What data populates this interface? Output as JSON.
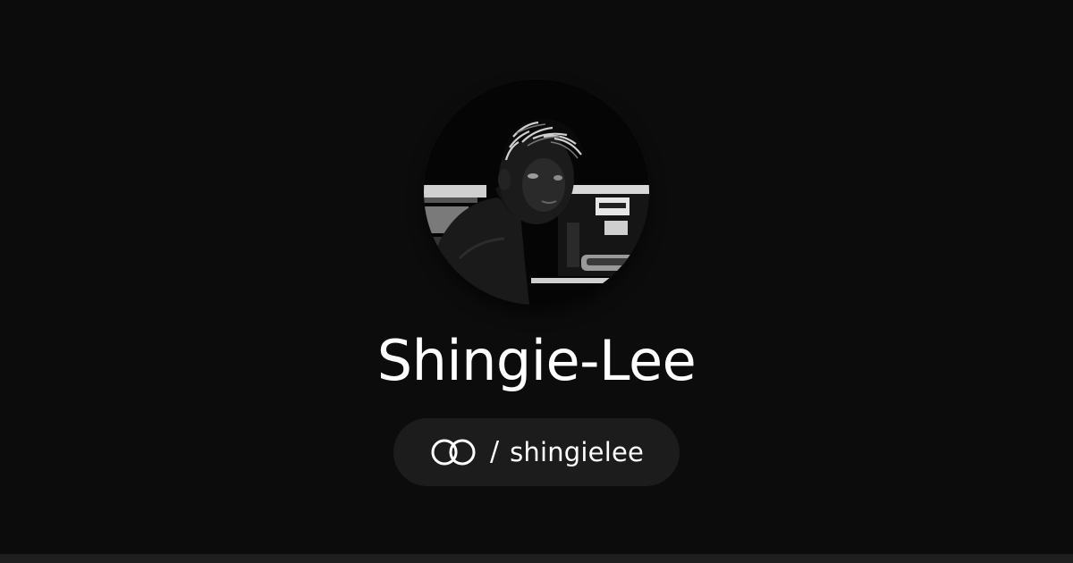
{
  "profile": {
    "name": "Shingie-Lee",
    "avatar_alt": "Profile photo",
    "handle_separator": "/",
    "handle": "shingielee"
  },
  "icons": {
    "brand": "linked-rings-icon"
  },
  "colors": {
    "background": "#0c0c0c",
    "pill_background": "#1c1c1c",
    "text": "#ffffff",
    "bottom_strip": "#1f1f1f"
  }
}
